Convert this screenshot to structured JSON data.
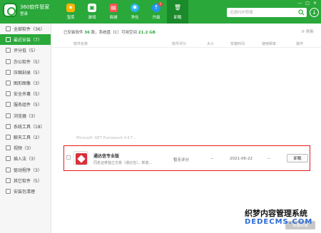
{
  "header": {
    "app_title": "360软件管家",
    "login_label": "登录",
    "nav": [
      {
        "label": "宝库",
        "icon": "star-icon"
      },
      {
        "label": "游戏",
        "icon": "gamepad-icon"
      },
      {
        "label": "商城",
        "icon": "shop-icon"
      },
      {
        "label": "净化",
        "icon": "purify-icon"
      },
      {
        "label": "升级",
        "icon": "upgrade-icon",
        "badge": "1"
      },
      {
        "label": "卸载",
        "icon": "trash-icon"
      }
    ],
    "search_placeholder": "迅速PDF转换",
    "window_controls": [
      "—",
      "□",
      "✕"
    ]
  },
  "sidebar": {
    "items": [
      {
        "label": "全部软件（36）"
      },
      {
        "label": "最近安装（7）"
      },
      {
        "label": "评分低（5）"
      },
      {
        "label": "办公软件（5）"
      },
      {
        "label": "压缩刻录（5）"
      },
      {
        "label": "图形图像（3）"
      },
      {
        "label": "安全杀毒（5）"
      },
      {
        "label": "服务组件（5）"
      },
      {
        "label": "浏览器（3）"
      },
      {
        "label": "系统工具（18）"
      },
      {
        "label": "聊天工具（2）"
      },
      {
        "label": "视频（3）"
      },
      {
        "label": "插入法（3）"
      },
      {
        "label": "驱动程序（3）"
      },
      {
        "label": "其它软件（5）"
      },
      {
        "label": "安装包清理"
      }
    ],
    "active_index": 1
  },
  "main": {
    "summary_prefix": "已安装软件",
    "summary_count": "36",
    "summary_mid": "款，系统盘（C）可用空间",
    "summary_space": "21.2 GB",
    "refresh_label": "刷新",
    "columns": [
      "软件名称",
      "软件评分",
      "大小",
      "安装时间",
      "使用频率",
      "操作"
    ],
    "faded_row_text": "Microsoft .NET Framework 4.8 T...",
    "row": {
      "name": "通达信专业版",
      "description": "同走证券独立交易（通达信），新富...",
      "rating": "暂无评分",
      "size": "--",
      "date": "2021-06-22",
      "frequency": "--",
      "uninstall_label": "卸载"
    },
    "batch_button": "批量卸载"
  },
  "watermark": {
    "line1": "织梦内容管理系统",
    "line2": "DEDECMS.COM"
  },
  "colors": {
    "brand_green": "#2aa83a",
    "active_tab": "#1b8a2a",
    "highlight_red": "#e11d1d"
  }
}
